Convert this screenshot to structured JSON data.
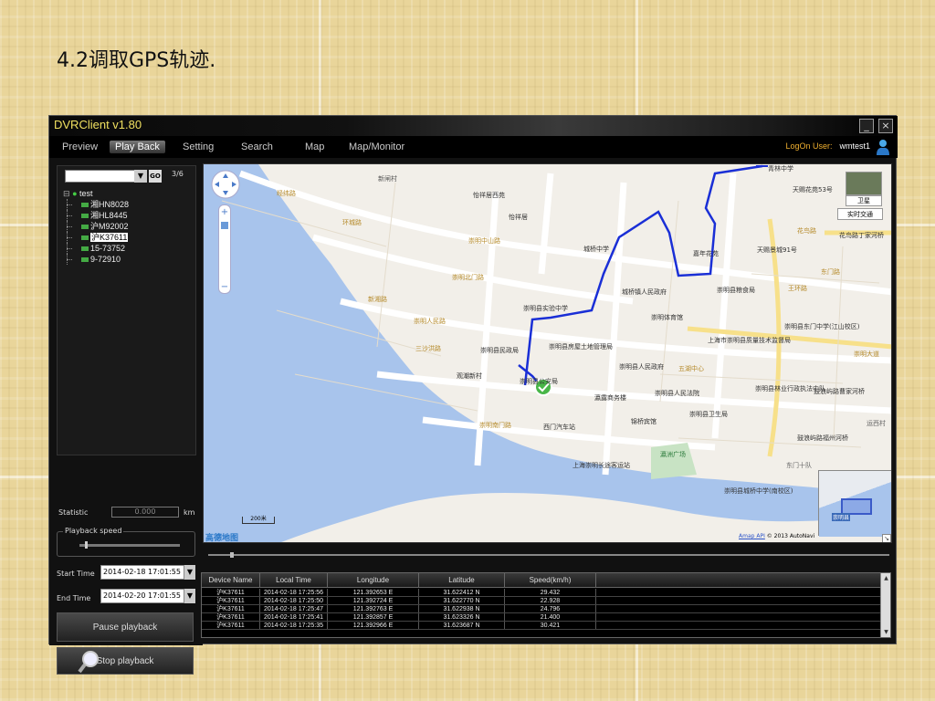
{
  "slide": {
    "title": "4.2调取GPS轨迹."
  },
  "app": {
    "title": "DVRClient v1.80",
    "minimize": "_",
    "close": "×"
  },
  "menu": {
    "items": [
      "Preview",
      "Play Back",
      "Setting",
      "Search",
      "Map",
      "Map/Monitor"
    ],
    "active": "Play Back",
    "logon_label": "LogOn User:",
    "logon_user": "wmtest1"
  },
  "device_tree": {
    "go_label": "GO",
    "count": "3/6",
    "root": "test",
    "devices": [
      "湘HN8028",
      "湘HL8445",
      "沪M92002",
      "沪K37611",
      "15-73752",
      "9-72910"
    ],
    "selected": "沪K37611"
  },
  "controls": {
    "statistic_label": "Statistic",
    "statistic_value": "0.000",
    "statistic_unit": "km",
    "playback_speed_label": "Playback speed",
    "playback_speed_level": 0.05,
    "start_time_label": "Start Time",
    "start_time_value": "2014-02-18   17:01:55",
    "end_time_label": "End Time",
    "end_time_value": "2014-02-20   17:01:55",
    "pause_label": "Pause playback",
    "stop_label": "Stop playback"
  },
  "map": {
    "satellite_label": "卫星",
    "traffic_label": "实时交通",
    "scale_label": "200米",
    "logo": "高德地图",
    "copyright": "© 2013 AutoNavi",
    "api_link": "Amap API",
    "route_color": "#1a2fd6",
    "water_color": "#a8c4ec",
    "minimap_label": "崇明县",
    "labels": {
      "qinglin": "青林中学",
      "tianyi": "天赐花苑53号",
      "yixiangju": "怡祥居西苑",
      "yixiangju2": "怡祥居",
      "xinzha": "新闸村",
      "chengqiao": "城桥中学",
      "jiannian": "嘉年花苑",
      "tianci": "天赐景城91号",
      "hualu": "花鸟路",
      "hualu2": "花鸟路丁家河桥",
      "shiyan": "崇明县实验中学",
      "renmin_gov": "城桥镇人民政府",
      "liangshi": "崇明县粮食局",
      "tiyu": "崇明体育馆",
      "dongmen": "崇明县东门中学(江山校区)",
      "minzheng": "崇明县民政局",
      "fangwu": "崇明县房屋土地管理局",
      "zhiliang": "上海市崇明县质量技术监督局",
      "xianrenmin": "崇明县人民政府",
      "guanchao": "观潮新村",
      "xiangyuan": "崇明县公安局",
      "linye": "崇明县林业行政执法中队",
      "guchao": "鼓浪屿路曹家河桥",
      "haiyu": "瀛露商务楼",
      "fayuan": "崇明县人民法院",
      "weisheng": "崇明县卫生局",
      "jinqiao": "锦桥宾馆",
      "ximen": "西门汽车站",
      "gulangyu": "鼓浪屿路福州河桥",
      "lanzhou": "瀛洲广场",
      "changtu": "上海崇明长途客运站",
      "chengqiao_zx": "崇明县城桥中学(南校区)",
      "yuncun": "运西村",
      "dongmenshi": "东门十队",
      "wanghuan": "王环路",
      "dongmenlu": "东门路",
      "chongming_da": "崇明大道",
      "zhongshan": "崇明中山路",
      "beimen": "崇明北门路",
      "nanmen": "崇明南门路",
      "xinglu": "新湘路",
      "renmin_lu": "崇明人民路",
      "shanhe": "三沙洪路",
      "wuhun": "五湖中心",
      "jingfa": "经纬路",
      "huancheng": "环城路"
    }
  },
  "table": {
    "columns": [
      "Device Name",
      "Local Time",
      "Longitude",
      "Latitude",
      "Speed(km/h)",
      ""
    ],
    "rows": [
      [
        "沪K37611",
        "2014-02-18 17:25:56",
        "121.392653 E",
        "31.622412 N",
        "29.432"
      ],
      [
        "沪K37611",
        "2014-02-18 17:25:50",
        "121.392724 E",
        "31.622770 N",
        "22.928"
      ],
      [
        "沪K37611",
        "2014-02-18 17:25:47",
        "121.392763 E",
        "31.622938 N",
        "24.796"
      ],
      [
        "沪K37611",
        "2014-02-18 17:25:41",
        "121.392857 E",
        "31.623326 N",
        "21.400"
      ],
      [
        "沪K37611",
        "2014-02-18 17:25:35",
        "121.392966 E",
        "31.623687 N",
        "30.421"
      ]
    ]
  }
}
